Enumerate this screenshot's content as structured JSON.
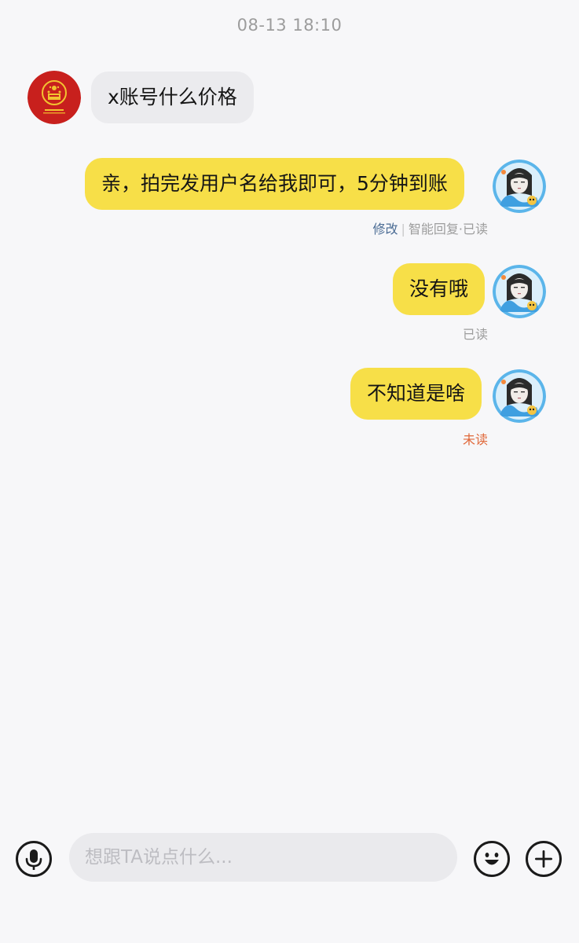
{
  "chat": {
    "timestamp": "08-13 18:10",
    "messages": [
      {
        "direction": "incoming",
        "text": "x账号什么价格",
        "avatar": "national-emblem-icon"
      },
      {
        "direction": "outgoing",
        "text": "亲，拍完发用户名给我即可，5分钟到账",
        "avatar": "anime-girl-avatar",
        "status": {
          "edit_label": "修改",
          "reply_type": "智能回复",
          "read_label": "·已读"
        }
      },
      {
        "direction": "outgoing",
        "text": "没有哦",
        "avatar": "anime-girl-avatar",
        "status": {
          "read_label": "已读"
        }
      },
      {
        "direction": "outgoing",
        "text": "不知道是啥",
        "avatar": "anime-girl-avatar",
        "status": {
          "read_label": "未读"
        }
      }
    ]
  },
  "input_bar": {
    "placeholder": "想跟TA说点什么...",
    "voice_icon": "microphone-icon",
    "emoji_icon": "smiley-icon",
    "more_icon": "plus-icon"
  },
  "colors": {
    "background": "#f7f7f9",
    "outgoing_bubble": "#f7df48",
    "incoming_bubble": "#ebebee",
    "unread": "#e0683a",
    "link": "#4a6b94"
  }
}
